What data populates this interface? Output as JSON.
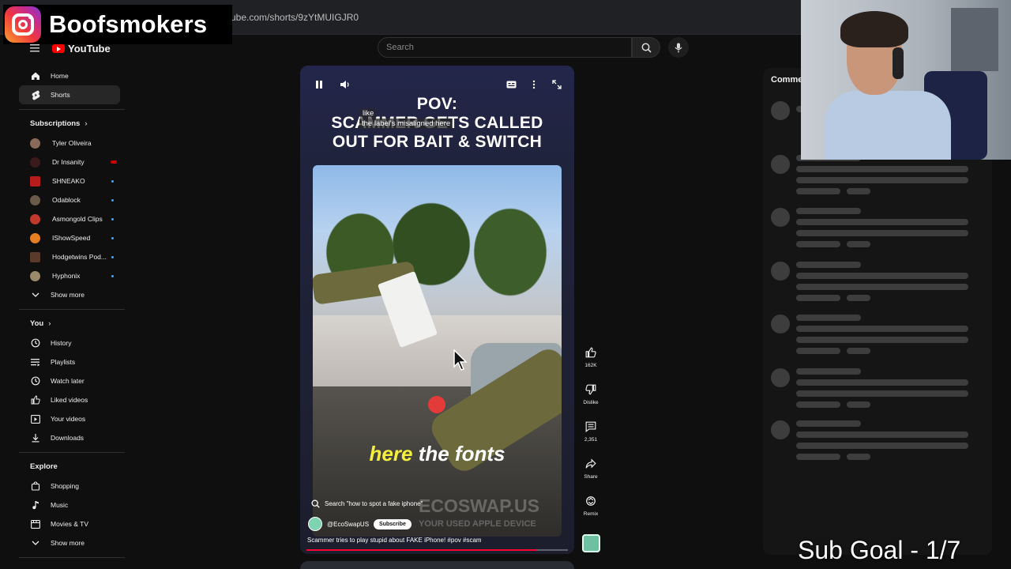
{
  "browser": {
    "url": "ube.com/shorts/9zYtMUIGJR0"
  },
  "overlay": {
    "instagram_handle": "Boofsmokers",
    "sub_goal": "Sub Goal - 1/7"
  },
  "header": {
    "logo_text": "YouTube",
    "search_placeholder": "Search"
  },
  "sidebar": {
    "main": [
      {
        "label": "Home",
        "icon": "home-icon"
      },
      {
        "label": "Shorts",
        "icon": "shorts-icon"
      }
    ],
    "subscriptions_title": "Subscriptions",
    "subscriptions": [
      {
        "label": "Tyler Oliveira",
        "color": "#8a6b5a",
        "live": false
      },
      {
        "label": "Dr Insanity",
        "color": "#3a1a1a",
        "live": true,
        "live_color": "#cc0000"
      },
      {
        "label": "SHNEAKO",
        "color": "#b71c1c",
        "live": true
      },
      {
        "label": "Odablock",
        "color": "#6a5a4a",
        "live": true
      },
      {
        "label": "Asmongold Clips",
        "color": "#c0392b",
        "live": true
      },
      {
        "label": "IShowSpeed",
        "color": "#e67e22",
        "live": true
      },
      {
        "label": "Hodgetwins Pod...",
        "color": "#5a3a2a",
        "live": true
      },
      {
        "label": "Hyphonix",
        "color": "#9a8a6a",
        "live": true
      }
    ],
    "show_more_1": "Show more",
    "you_title": "You",
    "you_items": [
      {
        "label": "History",
        "icon": "history-icon"
      },
      {
        "label": "Playlists",
        "icon": "playlists-icon"
      },
      {
        "label": "Watch later",
        "icon": "watch-later-icon"
      },
      {
        "label": "Liked videos",
        "icon": "like-icon"
      },
      {
        "label": "Your videos",
        "icon": "your-videos-icon"
      },
      {
        "label": "Downloads",
        "icon": "download-icon"
      }
    ],
    "explore_title": "Explore",
    "explore_items": [
      {
        "label": "Shopping",
        "icon": "shopping-icon"
      },
      {
        "label": "Music",
        "icon": "music-icon"
      },
      {
        "label": "Movies & TV",
        "icon": "movies-icon"
      }
    ],
    "show_more_2": "Show more"
  },
  "short": {
    "title_line1": "POV:",
    "title_line2": "SCAMMER GETS CALLED",
    "title_line3": "OUT FOR BAIT & SWITCH",
    "tooltip_top": "like",
    "tooltip_label": "the label's misaligned here",
    "caption_yellow": "here",
    "caption_white": "the fonts",
    "watermark": "ECOSWAP.US",
    "watermark_sub": "YOUR USED APPLE DEVICE",
    "search_suggestion": "Search \"how to spot a fake iphone\"",
    "channel": "@EcoSwapUS",
    "subscribe_label": "Subscribe",
    "description": "Scammer tries to play stupid about FAKE iPhone! #pov #scam",
    "progress": 0.88
  },
  "actions": {
    "like_count": "162K",
    "dislike_label": "Dislike",
    "comments_count": "2,351",
    "share_label": "Share",
    "remix_label": "Remix"
  },
  "comments": {
    "title": "Comme"
  }
}
